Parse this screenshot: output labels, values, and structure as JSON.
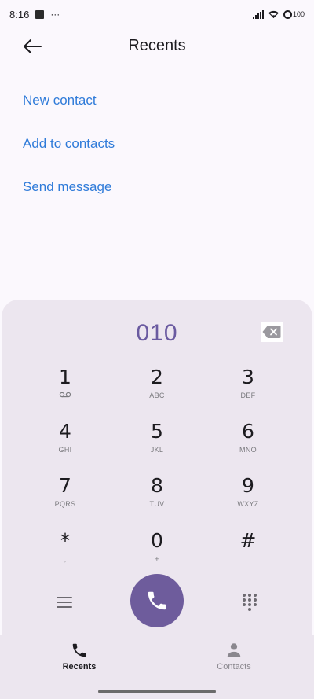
{
  "status_bar": {
    "time": "8:16",
    "overflow": "···",
    "battery_level": "100",
    "icons": [
      "notification-square-icon",
      "signal-icon",
      "wifi-icon",
      "battery-icon"
    ]
  },
  "header": {
    "title": "Recents",
    "back_icon": "arrow-left-icon"
  },
  "actions": {
    "new_contact": "New contact",
    "add_to_contacts": "Add to contacts",
    "send_message": "Send message"
  },
  "dialer": {
    "number": "010",
    "backspace_icon": "backspace-icon",
    "keys": [
      {
        "digit": "1",
        "letters": ""
      },
      {
        "digit": "2",
        "letters": "ABC"
      },
      {
        "digit": "3",
        "letters": "DEF"
      },
      {
        "digit": "4",
        "letters": "GHI"
      },
      {
        "digit": "5",
        "letters": "JKL"
      },
      {
        "digit": "6",
        "letters": "MNO"
      },
      {
        "digit": "7",
        "letters": "PQRS"
      },
      {
        "digit": "8",
        "letters": "TUV"
      },
      {
        "digit": "9",
        "letters": "WXYZ"
      },
      {
        "digit": "*",
        "letters": ","
      },
      {
        "digit": "0",
        "letters": "+"
      },
      {
        "digit": "#",
        "letters": ""
      }
    ],
    "menu_icon": "menu-icon",
    "call_icon": "phone-icon",
    "dialpad_icon": "dialpad-icon"
  },
  "bottom_nav": {
    "recents": "Recents",
    "contacts": "Contacts"
  },
  "colors": {
    "accent": "#6e5c9c",
    "link": "#2f7bd9",
    "number": "#6a5aa0",
    "panel": "#ece6ef",
    "background": "#fbf8fd"
  }
}
